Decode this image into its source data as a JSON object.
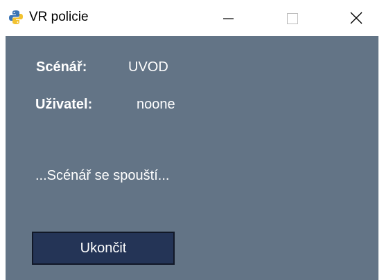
{
  "window": {
    "title": "VR policie",
    "app_icon": "python-icon",
    "controls": {
      "minimize_icon": "minimize-icon",
      "maximize_icon": "maximize-icon",
      "close_icon": "close-icon"
    }
  },
  "colors": {
    "content_background": "#637486",
    "button_background": "#243456",
    "text": "#ffffff"
  },
  "info": {
    "scenario_label": "Scénář:",
    "scenario_value": "UVOD",
    "user_label": "Uživatel:",
    "user_value": "noone"
  },
  "status": {
    "text": "...Scénář se spouští..."
  },
  "actions": {
    "quit_label": "Ukončit"
  }
}
